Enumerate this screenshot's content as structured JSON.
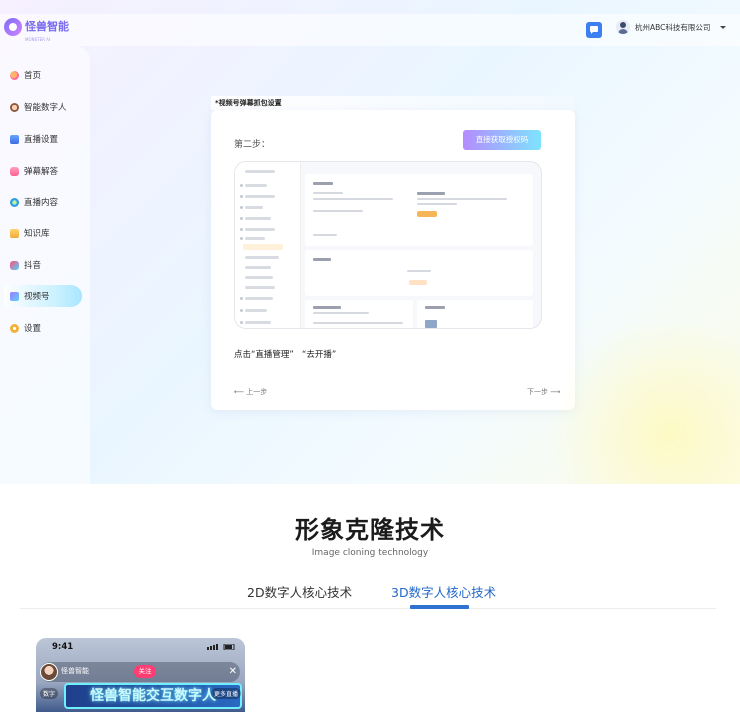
{
  "header": {
    "logo_text": "怪兽智能",
    "logo_sub": "MONSTER AI",
    "company": "杭州ABC科技有限公司"
  },
  "sidebar": {
    "items": [
      {
        "label": "首页",
        "icon": "home-icon",
        "active": false
      },
      {
        "label": "智能数字人",
        "icon": "digital-human-icon",
        "active": false
      },
      {
        "label": "直播设置",
        "icon": "live-settings-icon",
        "active": false
      },
      {
        "label": "弹幕解答",
        "icon": "danmu-icon",
        "active": false
      },
      {
        "label": "直播内容",
        "icon": "live-content-icon",
        "active": false
      },
      {
        "label": "知识库",
        "icon": "knowledge-icon",
        "active": false
      },
      {
        "label": "抖音",
        "icon": "douyin-icon",
        "active": false
      },
      {
        "label": "视频号",
        "icon": "channels-icon",
        "active": true
      },
      {
        "label": "设置",
        "icon": "settings-icon",
        "active": false
      }
    ]
  },
  "card": {
    "header_title": "*视频号弹幕抓包设置",
    "step_label": "第二步：",
    "get_code_button": "直接获取授权码",
    "instruction": "点击“直播管理”   “去开播”",
    "prev_label": "上一步",
    "next_label": "下一步"
  },
  "section": {
    "title": "形象克隆技术",
    "subtitle": "Image cloning technology",
    "tabs": [
      {
        "label": "2D数字人核心技术",
        "active": false
      },
      {
        "label": "3D数字人核心技术",
        "active": true
      }
    ]
  },
  "phone": {
    "time": "9:41",
    "follow": "关注",
    "banner": "怪兽智能交互数字人",
    "tag_left": "数字",
    "tag_right": "更多直播"
  },
  "colors": {
    "accent": "#2e72d2",
    "button_gradient_start": "#b48cff",
    "button_gradient_end": "#7ee3ff",
    "chat_button": "#3d7ff0"
  }
}
